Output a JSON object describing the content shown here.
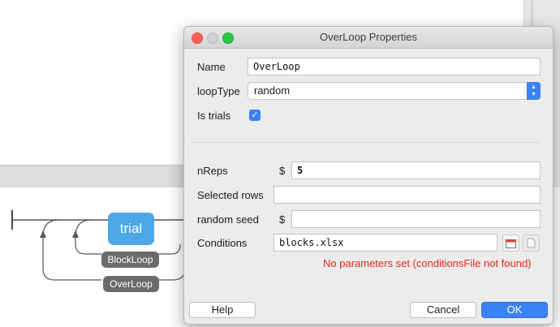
{
  "dialog": {
    "title": "OverLoop Properties",
    "fields": {
      "name": {
        "label": "Name",
        "value": "OverLoop"
      },
      "loop_type": {
        "label": "loopType",
        "value": "random"
      },
      "is_trials": {
        "label": "Is trials",
        "checked": true
      },
      "n_reps": {
        "label": "nReps",
        "prefix": "$",
        "value": "5"
      },
      "selected_rows": {
        "label": "Selected rows",
        "value": ""
      },
      "random_seed": {
        "label": "random seed",
        "prefix": "$",
        "value": ""
      },
      "conditions": {
        "label": "Conditions",
        "value": "blocks.xlsx"
      }
    },
    "error": "No parameters set (conditionsFile not found)",
    "buttons": {
      "help": "Help",
      "cancel": "Cancel",
      "ok": "OK"
    }
  },
  "flow": {
    "routine": "trial",
    "loops": [
      "BlockLoop",
      "OverLoop"
    ]
  },
  "colors": {
    "accent": "#3a82f7",
    "routine": "#4ba7e6",
    "error": "#e02a16",
    "loop_label": "#6b6b6b"
  },
  "icons": {
    "browse": "folder-calendar-icon",
    "preview": "document-icon",
    "check": "checkmark-icon",
    "select_arrows": "up-down-chevron-icon"
  }
}
